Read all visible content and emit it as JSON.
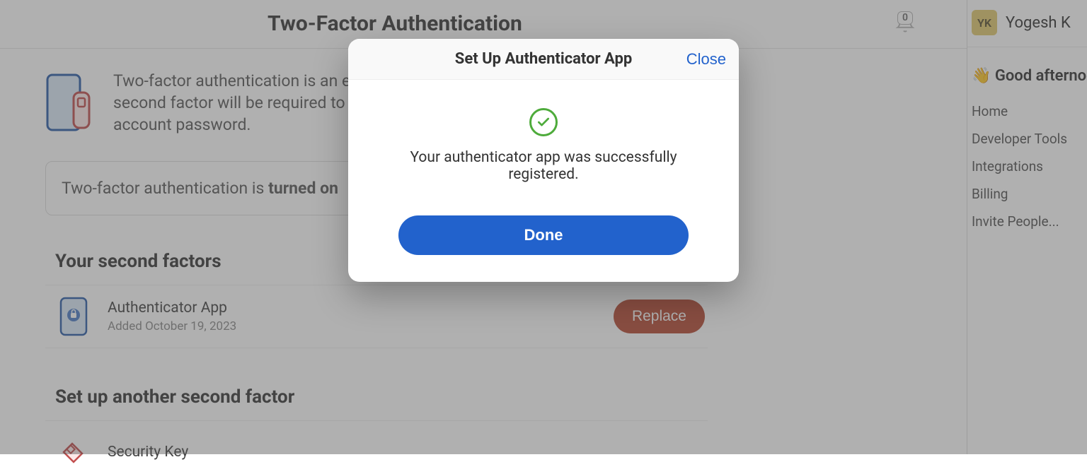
{
  "header": {
    "title": "Two-Factor Authentication",
    "notifications_count": "0"
  },
  "intro": {
    "text": "Two-factor authentication is an enhanced security measure. When turned on, a second factor will be required to sign in to your account in addition to your account password."
  },
  "status": {
    "prefix": "Two-factor authentication is ",
    "state": "turned on"
  },
  "sections": {
    "factors_heading": "Your second factors",
    "setup_heading": "Set up another second factor"
  },
  "factors": [
    {
      "name": "Authenticator App",
      "sub": "Added October 19, 2023",
      "action": "Replace"
    }
  ],
  "setup_options": [
    {
      "name": "Security Key"
    }
  ],
  "modal": {
    "title": "Set Up Authenticator App",
    "close": "Close",
    "message": "Your authenticator app was successfully registered.",
    "done": "Done"
  },
  "right": {
    "avatar_initials": "YK",
    "user_name": "Yogesh K",
    "greeting": "👋 Good afternoon",
    "nav": [
      "Home",
      "Developer Tools",
      "Integrations",
      "Billing",
      "Invite People..."
    ]
  }
}
